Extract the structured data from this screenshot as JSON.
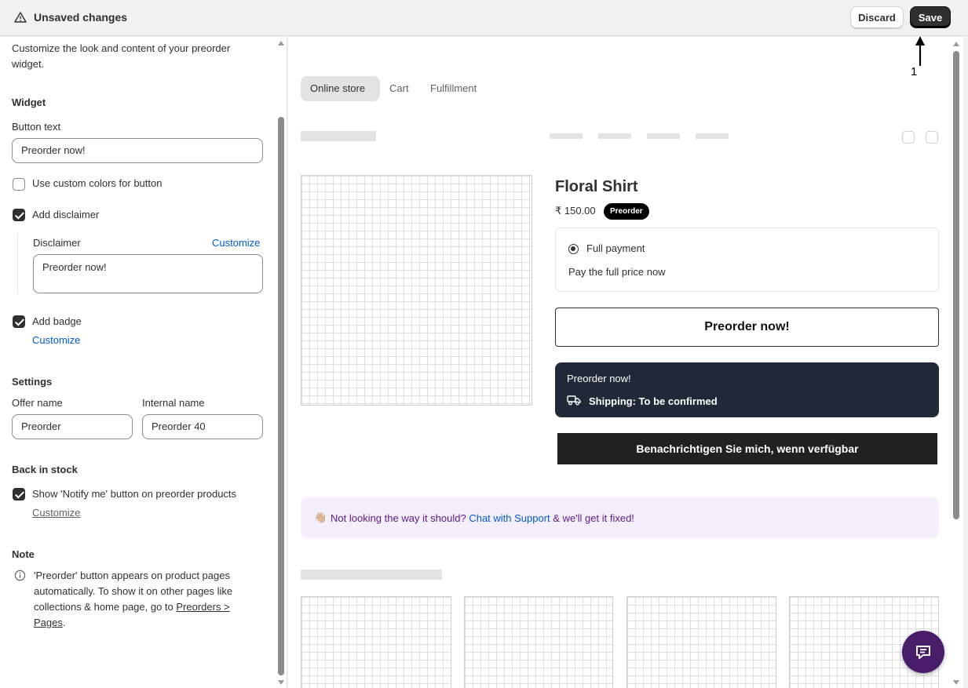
{
  "topbar": {
    "title": "Unsaved changes",
    "discard_label": "Discard",
    "save_label": "Save",
    "annotation": "1"
  },
  "left": {
    "intro": "Customize the look and content of your preorder widget.",
    "widget": {
      "heading": "Widget",
      "button_text_label": "Button text",
      "button_text_value": "Preorder now!",
      "custom_colors_label": "Use custom colors for button",
      "custom_colors_checked": false,
      "add_disclaimer_label": "Add disclaimer",
      "add_disclaimer_checked": true,
      "disclaimer_label": "Disclaimer",
      "disclaimer_customize": "Customize",
      "disclaimer_value": "Preorder now!",
      "add_badge_label": "Add badge",
      "add_badge_checked": true,
      "badge_customize": "Customize"
    },
    "settings": {
      "heading": "Settings",
      "offer_name_label": "Offer name",
      "offer_name_value": "Preorder",
      "internal_name_label": "Internal name",
      "internal_name_value": "Preorder 40"
    },
    "back_in_stock": {
      "heading": "Back in stock",
      "notify_label": "Show 'Notify me' button on preorder products",
      "notify_checked": true,
      "customize": "Customize"
    },
    "note": {
      "heading": "Note",
      "text_before": "'Preorder' button appears on product pages automatically. To show it on other pages like collections & home page, go to ",
      "link": "Preorders > Pages",
      "text_after": "."
    }
  },
  "preview": {
    "tabs": [
      {
        "label": "Online store",
        "active": true
      },
      {
        "label": "Cart",
        "active": false
      },
      {
        "label": "Fulfillment",
        "active": false
      }
    ],
    "product": {
      "title": "Floral Shirt",
      "price": "₹ 150.00",
      "badge": "Preorder",
      "payment_option": "Full payment",
      "payment_desc": "Pay the full price now",
      "preorder_button": "Preorder now!",
      "info_line1": "Preorder now!",
      "info_line2": "Shipping: To be confirmed",
      "notify_button": "Benachrichtigen Sie mich, wenn verfügbar"
    },
    "support": {
      "emoji": "👋🏼",
      "text_before": "Not looking the way it should? ",
      "link": "Chat with Support",
      "text_after": " & we'll get it fixed!"
    }
  },
  "colors": {
    "save_bg": "#303030",
    "link": "#005bd3",
    "info_dark_bg": "#1f2937",
    "support_bg": "#f5eefc",
    "chat_fab": "#4a1d6b"
  }
}
